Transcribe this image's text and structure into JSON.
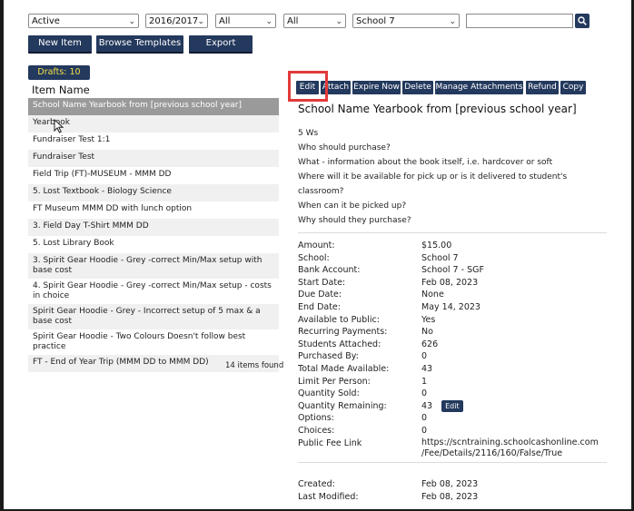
{
  "filters": {
    "status": "Active",
    "year": "2016/2017",
    "filter3": "All",
    "filter4": "All",
    "school": "School 7",
    "search_value": ""
  },
  "toolbar": {
    "new_item": "New Item",
    "browse_templates": "Browse Templates",
    "export": "Export"
  },
  "drafts_label": "Drafts: 10",
  "list": {
    "column_header": "Item Name",
    "items": [
      "School Name Yearbook from [previous school year]",
      "Yearbook",
      "Fundraiser Test 1:1",
      "Fundraiser Test",
      "Field Trip (FT)-MUSEUM - MMM DD",
      "5. Lost Textbook - Biology Science",
      "FT Museum MMM DD with lunch option",
      "3. Field Day T-Shirt MMM DD",
      "5. Lost Library Book",
      "3. Spirit Gear Hoodie - Grey -correct Min/Max setup with base cost",
      "4. Spirit Gear Hoodie - Grey -correct Min/Max setup - costs in choice",
      "Spirit Gear Hoodie - Grey - Incorrect setup of 5 max & a base cost",
      "Spirit Gear Hoodie - Two Colours Doesn't follow best practice",
      "FT - End of Year Trip (MMM DD to MMM DD)"
    ],
    "count_label": "14 items found"
  },
  "actions": {
    "edit": "Edit",
    "attach": "Attach",
    "expire_now": "Expire Now",
    "delete": "Delete",
    "manage_attachments": "Manage Attachments",
    "refund": "Refund",
    "copy": "Copy"
  },
  "detail": {
    "title": "School Name Yearbook from [previous school year]",
    "description": [
      "5 Ws",
      "Who should purchase?",
      "What - information about the book itself, i.e. hardcover or soft",
      "Where will it be available for pick up or is it delivered to student's",
      "classroom?",
      "When can it be picked up?",
      "Why should they purchase?"
    ],
    "fields": [
      {
        "k": "Amount:",
        "v": "$15.00"
      },
      {
        "k": "School:",
        "v": "School 7"
      },
      {
        "k": "Bank Account:",
        "v": "School 7 - SGF"
      },
      {
        "k": "Start Date:",
        "v": "Feb 08, 2023"
      },
      {
        "k": "Due Date:",
        "v": "None"
      },
      {
        "k": "End Date:",
        "v": "May 14, 2023"
      },
      {
        "k": "Available to Public:",
        "v": "Yes"
      },
      {
        "k": "Recurring Payments:",
        "v": "No"
      },
      {
        "k": "Students Attached:",
        "v": "626"
      },
      {
        "k": "Purchased By:",
        "v": "0"
      },
      {
        "k": "Total Made Available:",
        "v": "43"
      },
      {
        "k": "Limit Per Person:",
        "v": "1"
      },
      {
        "k": "Quantity Sold:",
        "v": "0"
      },
      {
        "k": "Quantity Remaining:",
        "v": "43"
      },
      {
        "k": "Options:",
        "v": "0"
      },
      {
        "k": "Choices:",
        "v": "0"
      }
    ],
    "quantity_edit": "Edit",
    "public_fee_link_label": "Public Fee Link",
    "public_fee_link_1": "https://scntraining.schoolcashonline.com",
    "public_fee_link_2": "/Fee/Details/2116/160/False/True",
    "created_label": "Created:",
    "created": "Feb 08, 2023",
    "modified_label": "Last Modified:",
    "modified": "Feb 08, 2023"
  },
  "colors": {
    "button_navy": "#23395d",
    "drafts_text": "#f5e14a",
    "highlight_red": "#e23a3a",
    "selected_row": "#9a9a9a"
  }
}
